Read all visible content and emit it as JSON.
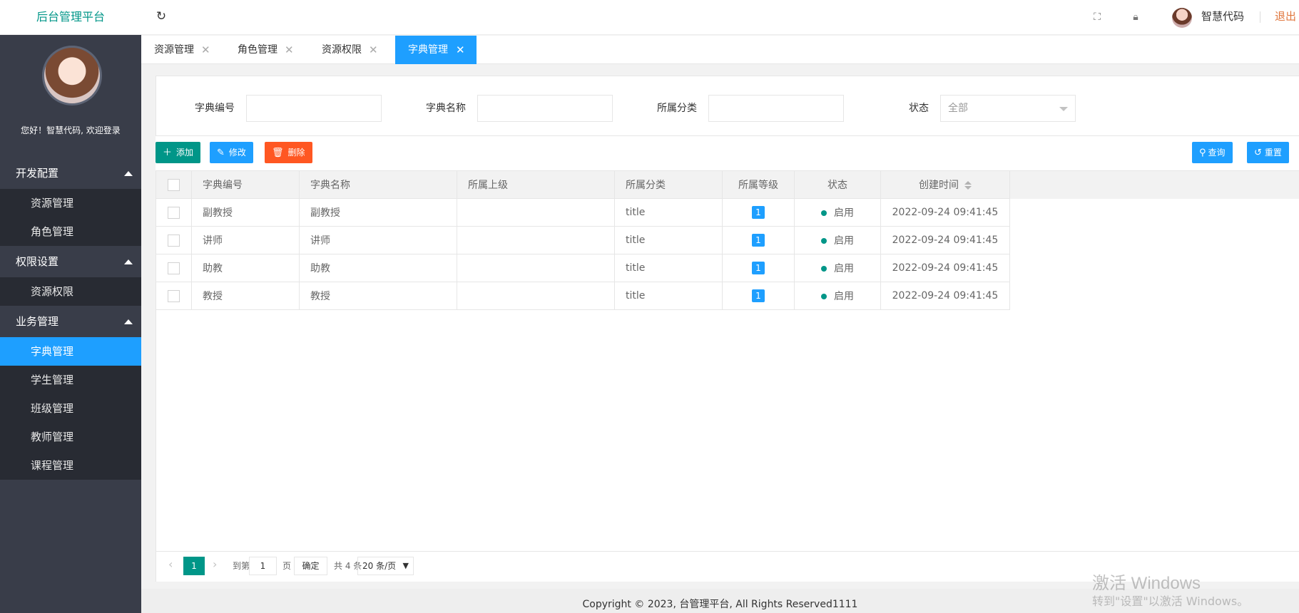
{
  "header": {
    "app_title": "后台管理平台",
    "username": "智慧代码",
    "logout": "退出",
    "icons": [
      "refresh-icon",
      "fullscreen-icon",
      "lock-icon"
    ]
  },
  "sidebar": {
    "welcome": "您好！智慧代码, 欢迎登录",
    "groups": [
      {
        "label": "开发配置",
        "items": [
          "资源管理",
          "角色管理"
        ]
      },
      {
        "label": "权限设置",
        "items": [
          "资源权限"
        ]
      },
      {
        "label": "业务管理",
        "items": [
          "字典管理",
          "学生管理",
          "班级管理",
          "教师管理",
          "课程管理"
        ]
      }
    ],
    "active_item": "字典管理"
  },
  "tabs": [
    {
      "label": "资源管理",
      "active": false
    },
    {
      "label": "角色管理",
      "active": false
    },
    {
      "label": "资源权限",
      "active": false
    },
    {
      "label": "字典管理",
      "active": true
    }
  ],
  "search": {
    "code_label": "字典编号",
    "name_label": "字典名称",
    "category_label": "所属分类",
    "status_label": "状态",
    "status_value": "全部"
  },
  "toolbar": {
    "add": "添加",
    "edit": "修改",
    "delete": "删除",
    "query": "查询",
    "reset": "重置"
  },
  "table": {
    "columns": [
      "字典编号",
      "字典名称",
      "所属上级",
      "所属分类",
      "所属等级",
      "状态",
      "创建时间"
    ],
    "rows": [
      {
        "code": "副教授",
        "name": "副教授",
        "parent": "",
        "category": "title",
        "level": "1",
        "status": "启用",
        "created": "2022-09-24 09:41:45"
      },
      {
        "code": "讲师",
        "name": "讲师",
        "parent": "",
        "category": "title",
        "level": "1",
        "status": "启用",
        "created": "2022-09-24 09:41:45"
      },
      {
        "code": "助教",
        "name": "助教",
        "parent": "",
        "category": "title",
        "level": "1",
        "status": "启用",
        "created": "2022-09-24 09:41:45"
      },
      {
        "code": "教授",
        "name": "教授",
        "parent": "",
        "category": "title",
        "level": "1",
        "status": "启用",
        "created": "2022-09-24 09:41:45"
      }
    ]
  },
  "pager": {
    "current_page": "1",
    "goto_label": "到第",
    "goto_value": "1",
    "page_unit": "页",
    "confirm": "确定",
    "total": "共 4 条",
    "limit": "20 条/页"
  },
  "footer": {
    "copyright": "Copyright © 2023, 台管理平台, All Rights Reserved1111"
  },
  "watermark": {
    "line1": "激活 Windows",
    "line2": "转到\"设置\"以激活 Windows。"
  },
  "colors": {
    "brand": "#009688",
    "accent": "#1e9fff",
    "danger": "#ff5722",
    "sidebar": "#393d49",
    "logout": "#e0763d"
  }
}
